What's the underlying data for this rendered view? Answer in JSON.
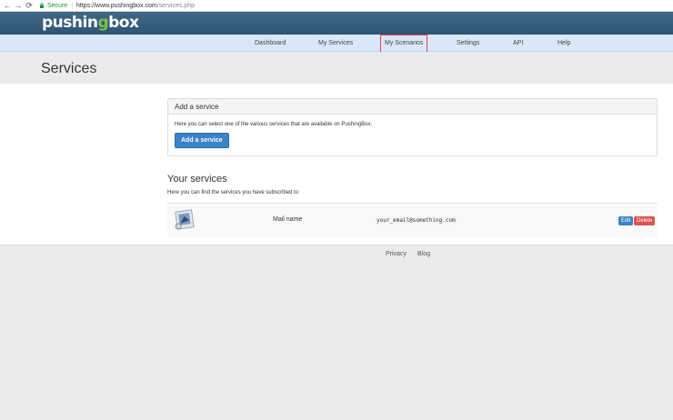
{
  "browser": {
    "secure_label": "Secure",
    "url_host": "https://www.pushingbox.com",
    "url_path": "/services.php"
  },
  "brand": {
    "logo_part1": "pushin",
    "logo_part2": "g",
    "logo_part3": "box"
  },
  "nav": {
    "items": [
      "Dashboard",
      "My Services",
      "My Scenarios",
      "Settings",
      "API",
      "Help"
    ],
    "highlighted": "My Scenarios"
  },
  "page": {
    "title": "Services"
  },
  "add_panel": {
    "heading": "Add a service",
    "description": "Here you can select one of the various services that are available on PushingBox.",
    "button_label": "Add a service"
  },
  "your_services": {
    "title": "Your services",
    "subtitle": "Here you can find the services you have subscribed to",
    "rows": [
      {
        "name": "Mail name",
        "value": "your_email@something.com",
        "edit_label": "Edit",
        "delete_label": "Delete"
      }
    ]
  },
  "footer": {
    "links": [
      "Privacy",
      "Blog"
    ]
  },
  "colors": {
    "brand": "#2f5474",
    "nav_bg": "#d9e7f8",
    "primary": "#3a83c6",
    "danger": "#d9534f",
    "highlight": "#e0424a"
  }
}
